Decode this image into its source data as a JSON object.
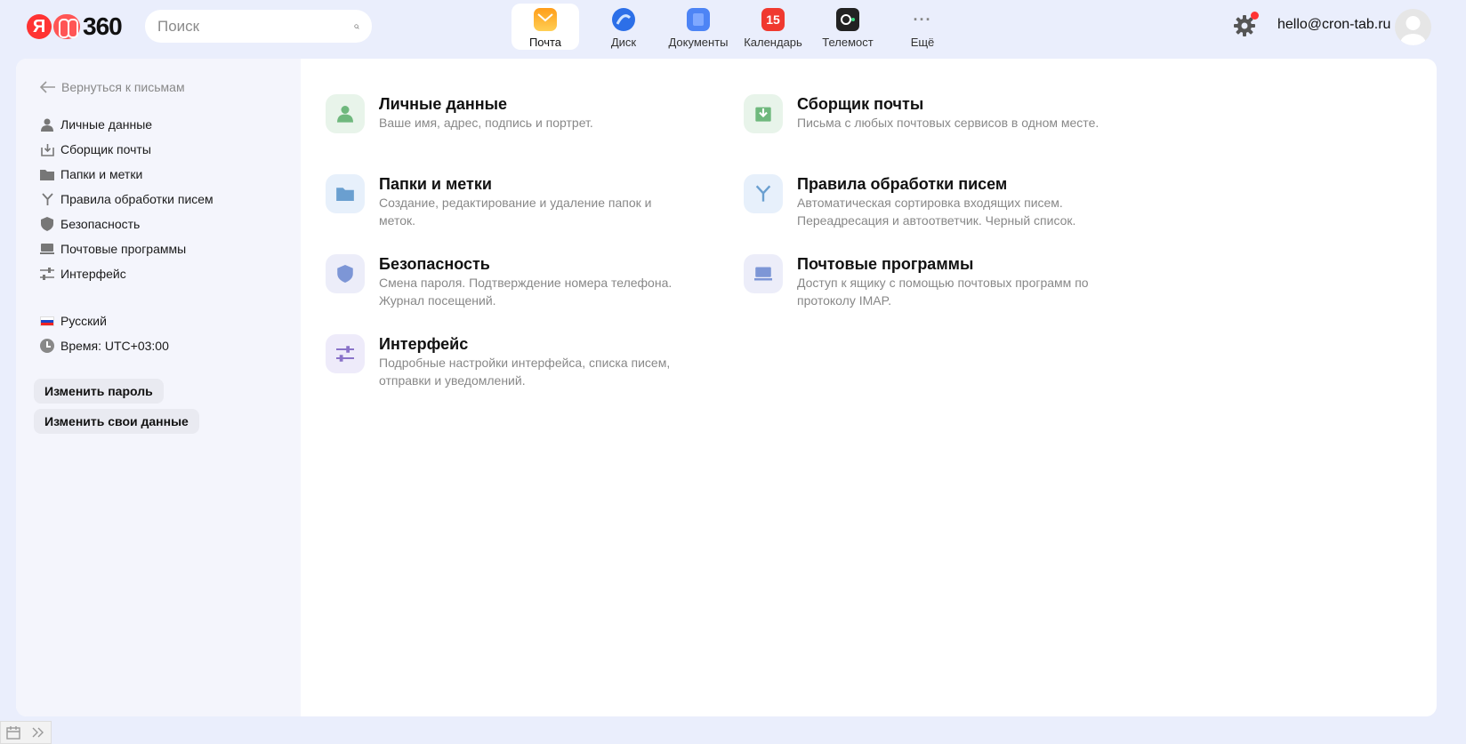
{
  "header": {
    "logo_ya": "Я",
    "logo_num": "360",
    "search_placeholder": "Поиск",
    "apps": [
      {
        "label": "Почта",
        "icon": "mail-icon",
        "active": true
      },
      {
        "label": "Диск",
        "icon": "disk-icon"
      },
      {
        "label": "Документы",
        "icon": "docs-icon"
      },
      {
        "label": "Календарь",
        "icon": "calendar-icon",
        "badge": "15"
      },
      {
        "label": "Телемост",
        "icon": "telemost-icon"
      },
      {
        "label": "Ещё",
        "icon": "more-icon",
        "glyph": "···"
      }
    ],
    "user_email": "hello@cron-tab.ru"
  },
  "sidebar": {
    "back_label": "Вернуться к письмам",
    "items": [
      {
        "label": "Личные данные",
        "icon": "person-icon"
      },
      {
        "label": "Сборщик почты",
        "icon": "inbox-download-icon"
      },
      {
        "label": "Папки и метки",
        "icon": "folder-icon"
      },
      {
        "label": "Правила обработки писем",
        "icon": "filter-rules-icon"
      },
      {
        "label": "Безопасность",
        "icon": "shield-icon"
      },
      {
        "label": "Почтовые программы",
        "icon": "laptop-icon"
      },
      {
        "label": "Интерфейс",
        "icon": "sliders-icon"
      }
    ],
    "language": "Русский",
    "time": "Время: UTC+03:00",
    "change_password": "Изменить пароль",
    "change_data": "Изменить свои данные"
  },
  "tiles": [
    {
      "title": "Личные данные",
      "desc": "Ваше имя, адрес, подпись и портрет."
    },
    {
      "title": "Сборщик почты",
      "desc": "Письма с любых почтовых сервисов в одном месте."
    },
    {
      "title": "Папки и метки",
      "desc": "Создание, редактирование и удаление папок и меток."
    },
    {
      "title": "Правила обработки писем",
      "desc": "Автоматическая сортировка входящих писем. Переадресация и автоответчик. Черный список."
    },
    {
      "title": "Безопасность",
      "desc": "Смена пароля. Подтверждение номера телефона. Журнал посещений."
    },
    {
      "title": "Почтовые программы",
      "desc": "Доступ к ящику с помощью почтовых программ по протоколу IMAP."
    },
    {
      "title": "Интерфейс",
      "desc": "Подробные настройки интерфейса, списка писем, отправки и уведомлений."
    }
  ],
  "colors": {
    "page_bg": "#eaeefc",
    "accent_red": "#f33",
    "sidebar_bg": "#f4f5fc"
  }
}
